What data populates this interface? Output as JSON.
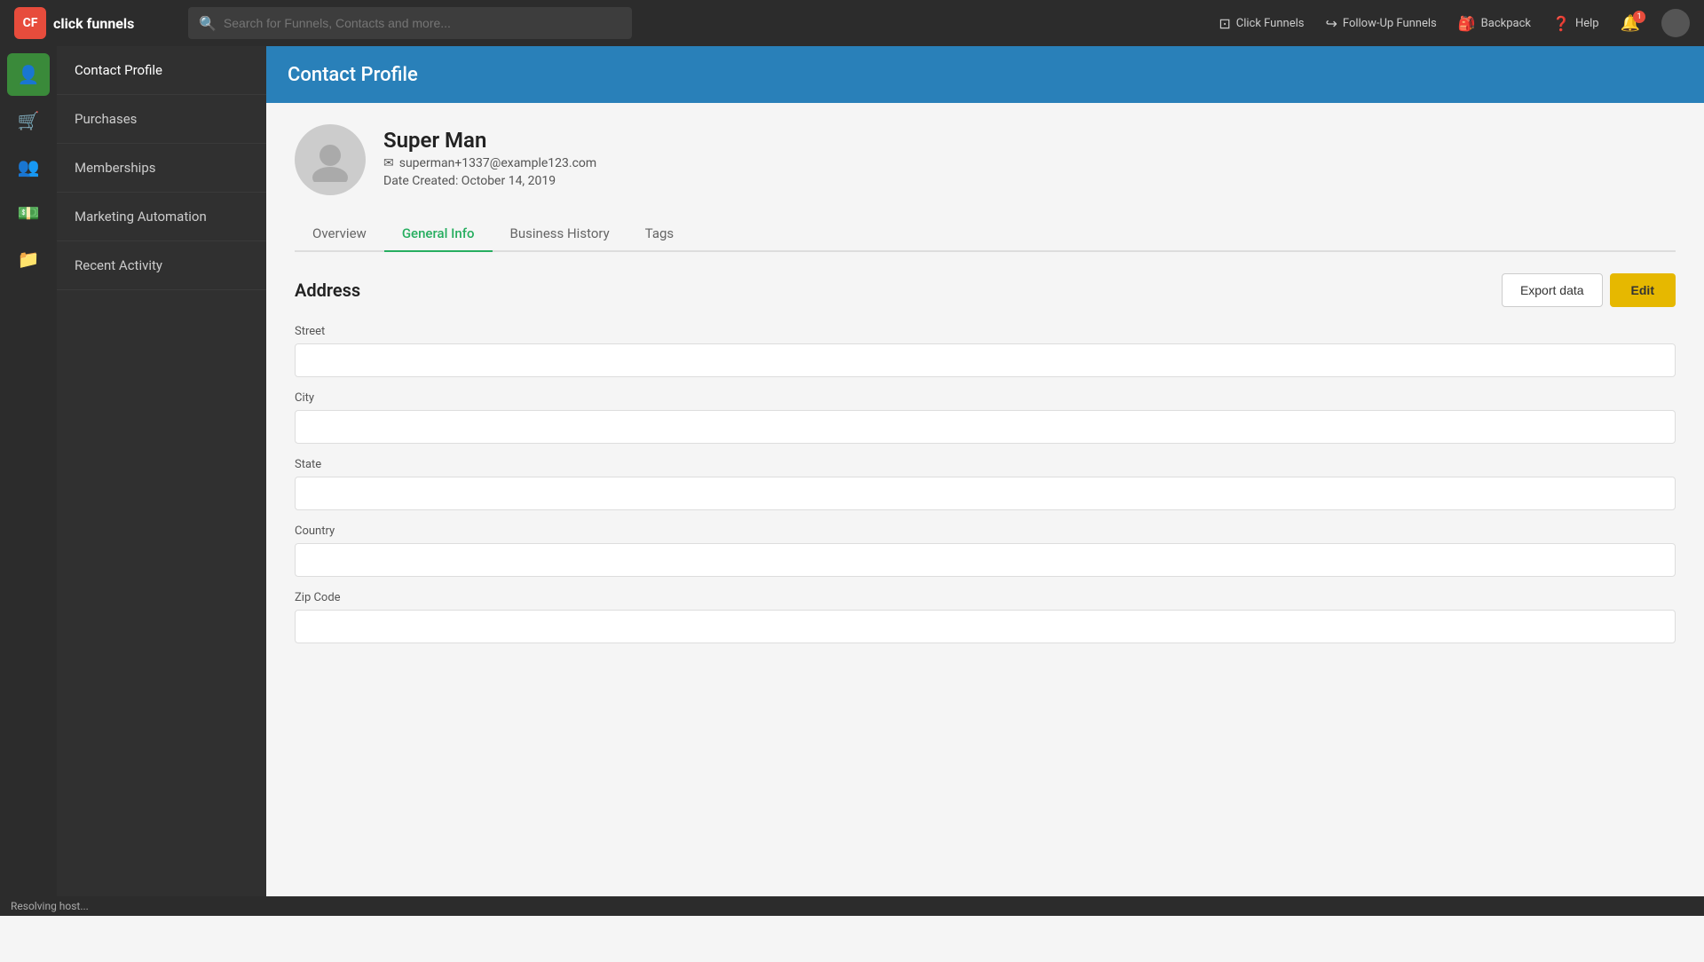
{
  "topNav": {
    "logo_text": "click funnels",
    "search_placeholder": "Search for Funnels, Contacts and more...",
    "links": [
      {
        "label": "Click Funnels",
        "icon": "⊡"
      },
      {
        "label": "Follow-Up Funnels",
        "icon": "↪"
      },
      {
        "label": "Backpack",
        "icon": "🎒"
      },
      {
        "label": "Help",
        "icon": "?"
      }
    ],
    "notification_count": "1"
  },
  "iconSidebar": {
    "items": [
      {
        "name": "contact-profile-icon",
        "icon": "👤",
        "active": true
      },
      {
        "name": "purchases-icon",
        "icon": "🛒",
        "active": false
      },
      {
        "name": "memberships-icon",
        "icon": "👥",
        "active": false
      },
      {
        "name": "marketing-icon",
        "icon": "💵",
        "active": false
      },
      {
        "name": "recent-activity-icon",
        "icon": "📁",
        "active": false
      }
    ]
  },
  "textSidebar": {
    "items": [
      {
        "label": "Contact Profile",
        "active": true
      },
      {
        "label": "Purchases",
        "active": false
      },
      {
        "label": "Memberships",
        "active": false
      },
      {
        "label": "Marketing Automation",
        "active": false
      },
      {
        "label": "Recent Activity",
        "active": false
      }
    ]
  },
  "pageHeader": {
    "title": "Contact Profile"
  },
  "profile": {
    "name": "Super Man",
    "email": "superman+1337@example123.com",
    "date_created": "Date Created: October 14, 2019"
  },
  "tabs": [
    {
      "label": "Overview",
      "active": false
    },
    {
      "label": "General Info",
      "active": true
    },
    {
      "label": "Business History",
      "active": false
    },
    {
      "label": "Tags",
      "active": false
    }
  ],
  "addressSection": {
    "title": "Address",
    "export_label": "Export data",
    "edit_label": "Edit",
    "fields": [
      {
        "label": "Street",
        "value": ""
      },
      {
        "label": "City",
        "value": ""
      },
      {
        "label": "State",
        "value": ""
      },
      {
        "label": "Country",
        "value": ""
      },
      {
        "label": "Zip Code",
        "value": ""
      }
    ]
  },
  "statusBar": {
    "text": "Resolving host..."
  }
}
